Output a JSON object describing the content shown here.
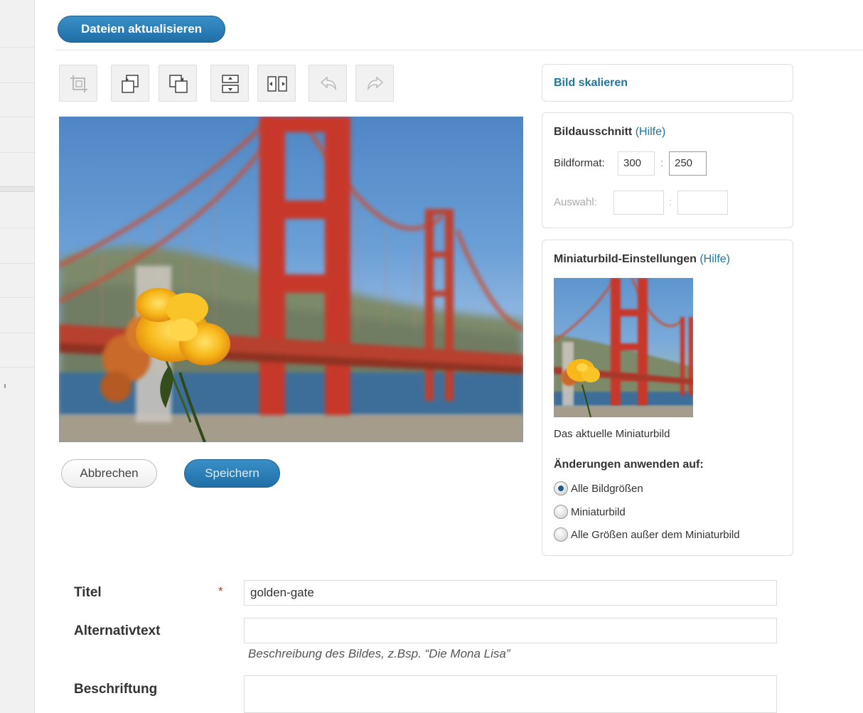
{
  "header": {
    "update_files_label": "Dateien aktualisieren"
  },
  "toolbar": {
    "tools": [
      {
        "icon": "crop-icon",
        "enabled": false
      },
      {
        "icon": "rotate-left-icon",
        "enabled": true
      },
      {
        "icon": "rotate-right-icon",
        "enabled": true
      },
      {
        "icon": "flip-vertical-icon",
        "enabled": true
      },
      {
        "icon": "flip-horizontal-icon",
        "enabled": true
      },
      {
        "icon": "undo-icon",
        "enabled": false
      },
      {
        "icon": "redo-icon",
        "enabled": false
      }
    ]
  },
  "actions": {
    "cancel_label": "Abbrechen",
    "save_label": "Speichern"
  },
  "scale_panel": {
    "title": "Bild skalieren"
  },
  "crop_panel": {
    "title": "Bildausschnitt",
    "help": "(Hilfe)",
    "ratio_label": "Bildformat:",
    "ratio_width": "300",
    "ratio_height": "250",
    "separator": ":",
    "selection_label": "Auswahl:",
    "selection_width": "",
    "selection_height": ""
  },
  "thumb_panel": {
    "title": "Miniaturbild-Einstellungen",
    "help": "(Hilfe)",
    "caption": "Das aktuelle Miniaturbild",
    "apply_heading": "Änderungen anwenden auf:",
    "options": [
      {
        "label": "Alle Bildgrößen",
        "checked": true
      },
      {
        "label": "Miniaturbild",
        "checked": false
      },
      {
        "label": "Alle Größen außer dem Miniaturbild",
        "checked": false
      }
    ]
  },
  "form": {
    "title_label": "Titel",
    "required_mark": "*",
    "title_value": "golden-gate",
    "alt_label": "Alternativtext",
    "alt_value": "",
    "alt_hint": "Beschreibung des Bildes, z.Bsp. “Die Mona Lisa”",
    "caption_label": "Beschriftung",
    "caption_value": ""
  },
  "colors": {
    "accent": "#21759b",
    "button_blue": "#2a7fb8",
    "bridge_red": "#c8392a"
  }
}
